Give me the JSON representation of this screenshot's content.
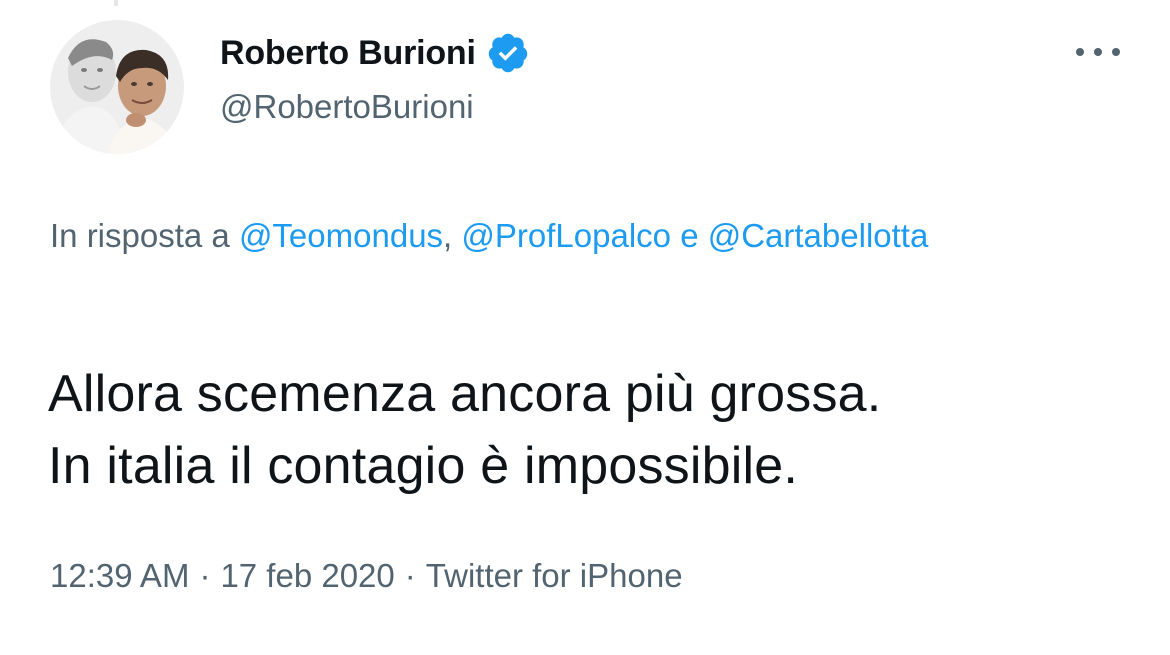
{
  "author": {
    "display_name": "Roberto Burioni",
    "handle": "@RobertoBurioni",
    "verified": true,
    "avatar_icon": "profile-photo"
  },
  "menu": {
    "icon": "more-horizontal-icon"
  },
  "reply": {
    "prefix": "In risposta a",
    "mentions": [
      "@Teomondus",
      "@ProfLopalco",
      "@Cartabellotta"
    ],
    "separator_comma": ",",
    "conjunction": "e"
  },
  "tweet": {
    "lines": [
      "Allora scemenza ancora più grossa.",
      "In italia il contagio è impossibile."
    ]
  },
  "meta": {
    "time": "12:39 AM",
    "date": "17 feb 2020",
    "source": "Twitter for iPhone",
    "separator": "·"
  },
  "colors": {
    "text": "#0f1419",
    "secondary": "#536471",
    "accent": "#1d9bf0"
  }
}
